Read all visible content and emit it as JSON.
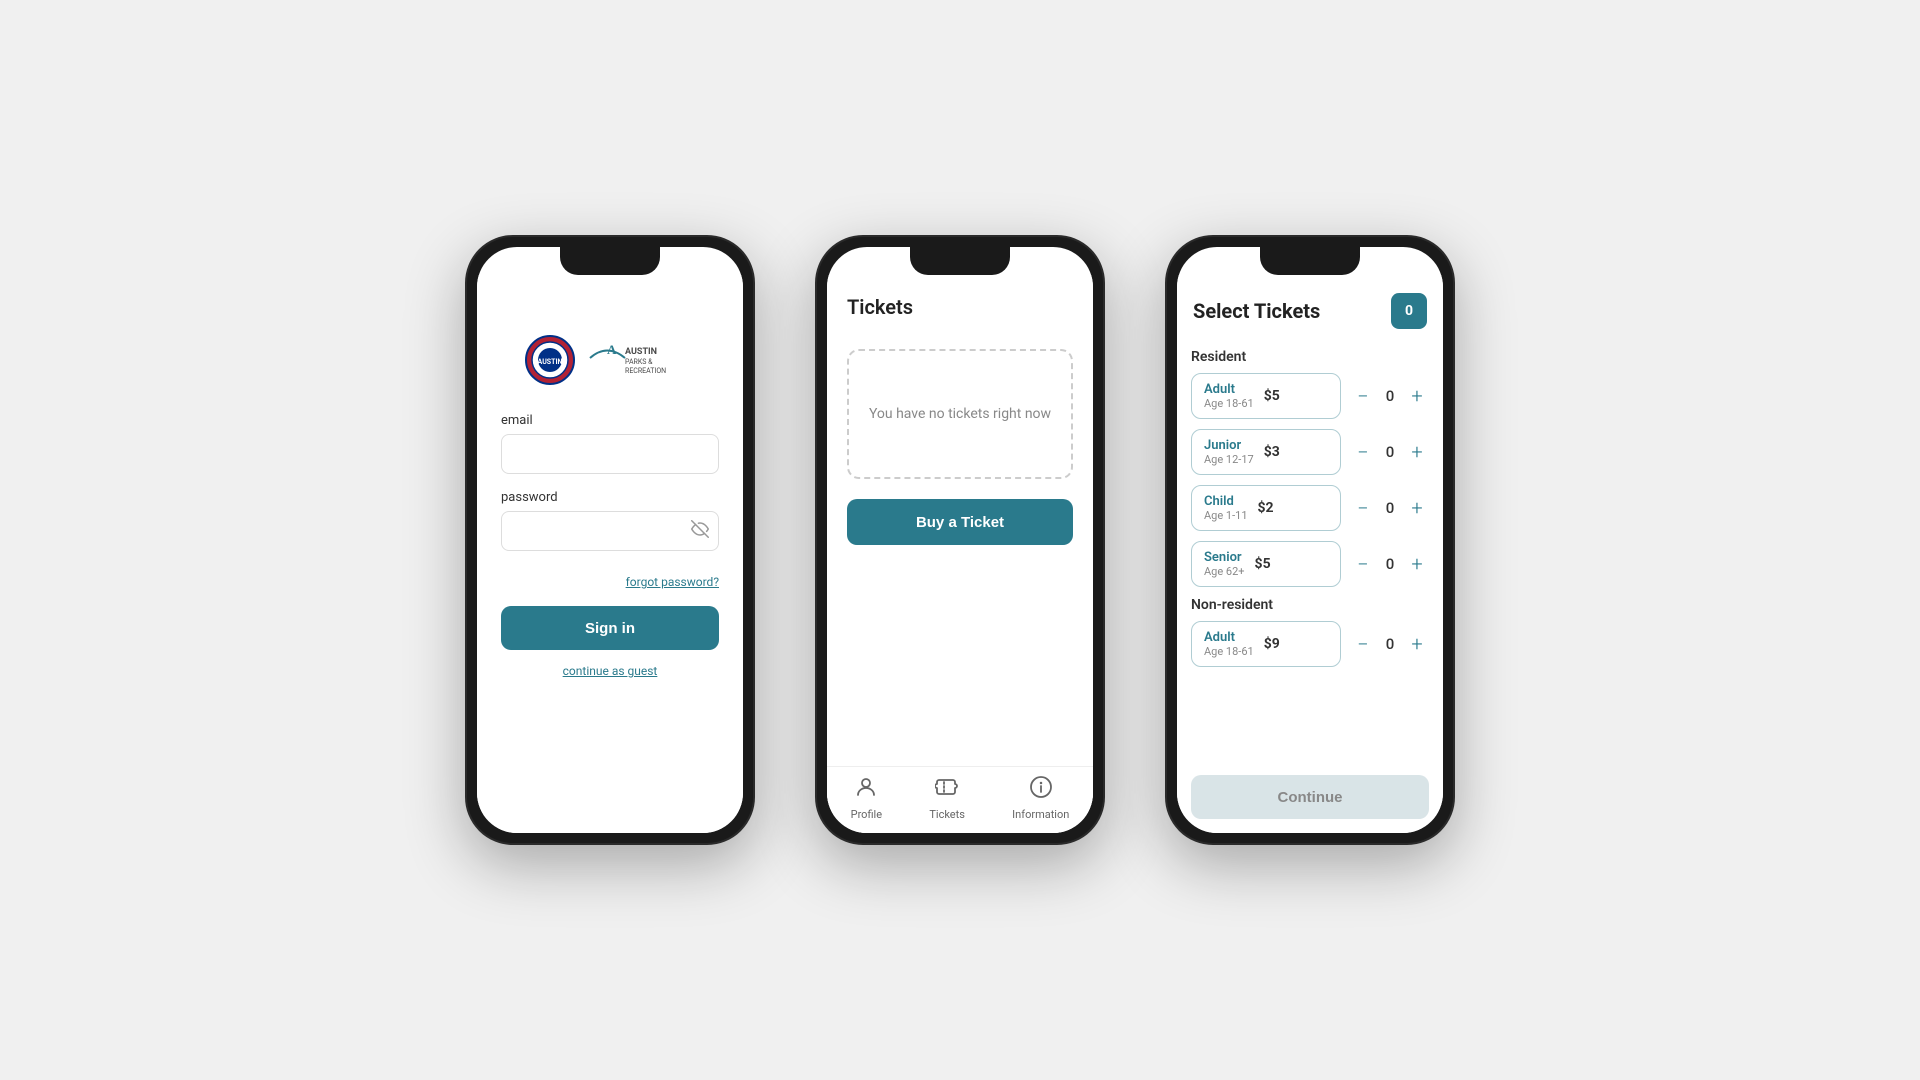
{
  "phone1": {
    "email_label": "email",
    "password_label": "password",
    "forgot_link": "forgot password?",
    "signin_btn": "Sign in",
    "guest_link": "continue as guest"
  },
  "phone2": {
    "title": "Tickets",
    "empty_text": "You have no tickets right now",
    "buy_btn": "Buy a Ticket",
    "nav": {
      "profile": "Profile",
      "tickets": "Tickets",
      "information": "Information"
    }
  },
  "phone3": {
    "title": "Select Tickets",
    "badge": "0",
    "resident_label": "Resident",
    "nonresident_label": "Non-resident",
    "tickets": [
      {
        "type": "Adult",
        "age": "Age 18-61",
        "price": "$5",
        "qty": "0",
        "section": "resident"
      },
      {
        "type": "Junior",
        "age": "Age 12-17",
        "price": "$3",
        "qty": "0",
        "section": "resident"
      },
      {
        "type": "Child",
        "age": "Age 1-11",
        "price": "$2",
        "qty": "0",
        "section": "resident"
      },
      {
        "type": "Senior",
        "age": "Age 62+",
        "price": "$5",
        "qty": "0",
        "section": "resident"
      },
      {
        "type": "Adult",
        "age": "Age 18-61",
        "price": "$9",
        "qty": "0",
        "section": "nonresident"
      }
    ],
    "continue_btn": "Continue"
  }
}
